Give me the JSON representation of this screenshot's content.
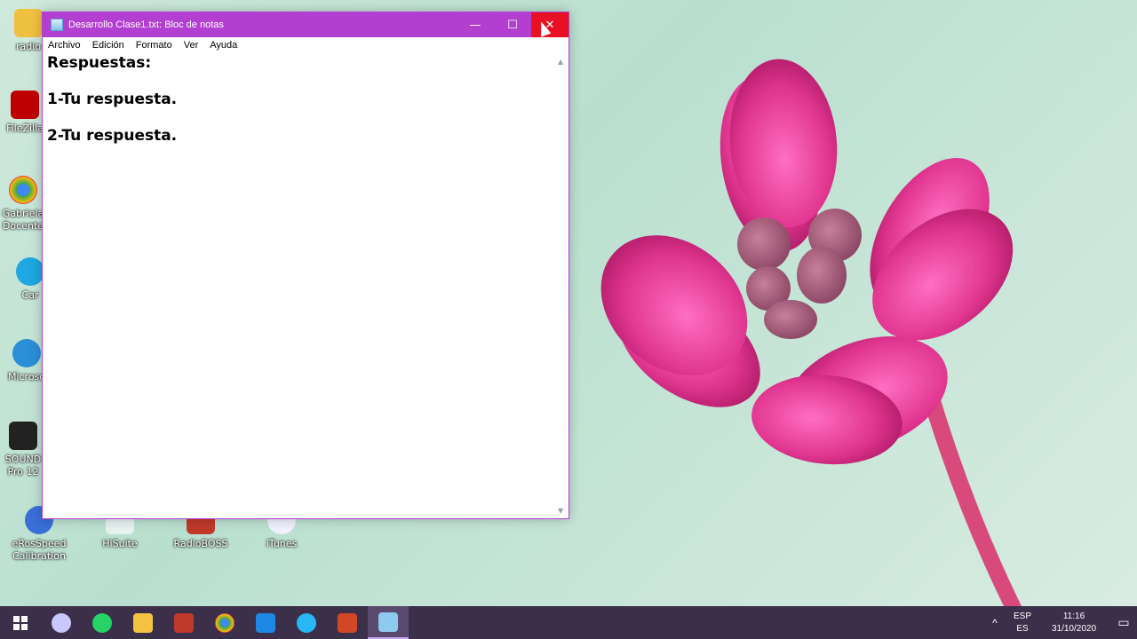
{
  "desktop": {
    "icons": [
      {
        "label": "radio"
      },
      {
        "label": "FileZilla"
      },
      {
        "label": "Gabriela Docente"
      },
      {
        "label": "Car"
      },
      {
        "label": "Microso"
      },
      {
        "label": "SOUND Pro 12"
      },
      {
        "label": "eRosSpeed Calibration"
      },
      {
        "label": "HiSuite"
      },
      {
        "label": "RadioBOSS"
      },
      {
        "label": "iTunes"
      }
    ]
  },
  "window": {
    "title": "Desarrollo Clase1.txt: Bloc de notas",
    "minimize_glyph": "—",
    "maximize_glyph": "☐",
    "close_glyph": "✕",
    "menu": [
      "Archivo",
      "Edición",
      "Formato",
      "Ver",
      "Ayuda"
    ],
    "content": "Respuestas:\n\n1-Tu respuesta.\n\n2-Tu respuesta."
  },
  "taskbar": {
    "items": [
      {
        "icon": "windows-start-icon",
        "color": "#ffffff"
      },
      {
        "icon": "cloud-icon",
        "color": "#c8c8ff"
      },
      {
        "icon": "whatsapp-icon",
        "color": "#25d366"
      },
      {
        "icon": "folder-icon",
        "color": "#f5c342"
      },
      {
        "icon": "app-s-icon",
        "color": "#c0392b"
      },
      {
        "icon": "chrome-icon",
        "color": "#4caf50"
      },
      {
        "icon": "photos-icon",
        "color": "#1e88e5"
      },
      {
        "icon": "c-app-icon",
        "color": "#29b6f6"
      },
      {
        "icon": "powerpoint-icon",
        "color": "#d24726"
      },
      {
        "icon": "notepad-icon",
        "color": "#8ec9ef"
      }
    ],
    "tray": {
      "chevron": "^",
      "lang_top": "ESP",
      "lang_bottom": "ES",
      "time": "11:16",
      "date": "31/10/2020",
      "notification_glyph": "▭"
    }
  },
  "colors": {
    "titlebar": "#b33fd1",
    "close": "#e81123",
    "taskbar": "#3b2f4a"
  }
}
